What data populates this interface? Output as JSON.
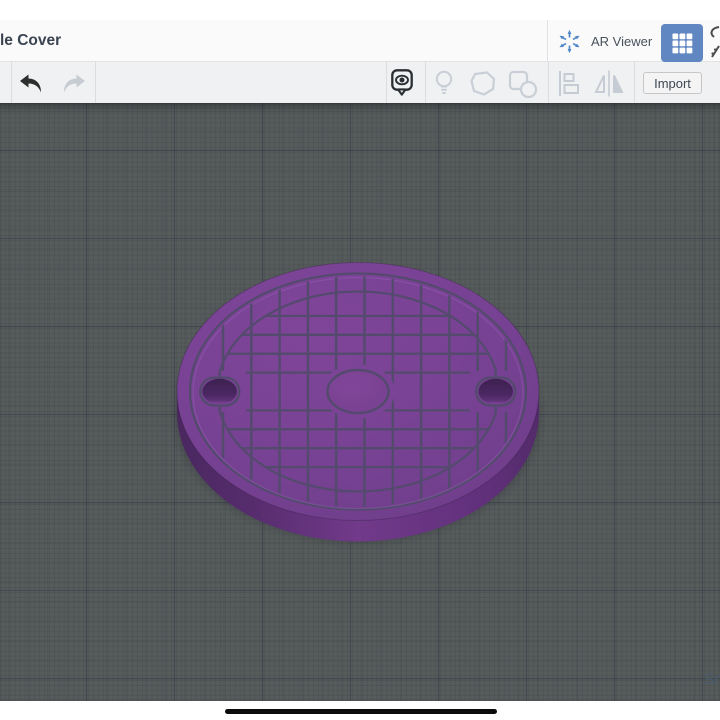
{
  "header": {
    "title": "le Cover",
    "ar_viewer_label": "AR Viewer"
  },
  "toolbar": {
    "import_label": "Import",
    "icon_names": [
      "undo",
      "redo",
      "annotation-eye",
      "lightbulb",
      "shape-generators",
      "basic-shapes",
      "align",
      "mirror"
    ]
  },
  "canvas": {
    "snap_label": "Sn",
    "background": "#565b5c"
  },
  "model": {
    "name": "manhole-cover",
    "top_color": "#784294",
    "side_color": "#713a8a",
    "groove_color": "#544a6e",
    "hole_color": "#4a2761"
  },
  "colors": {
    "accent_blue_button": "#6187c3",
    "ar_icon_blue": "#4d86c9"
  }
}
